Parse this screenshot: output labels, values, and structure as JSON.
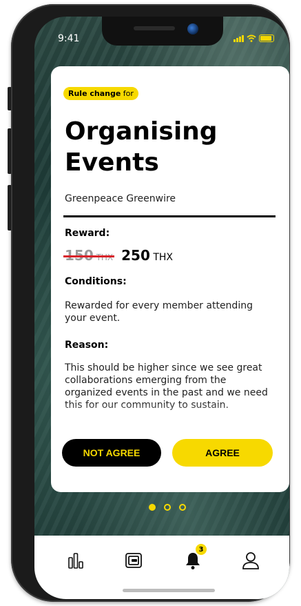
{
  "status": {
    "time": "9:41"
  },
  "card": {
    "badge_bold": "Rule change",
    "badge_rest": " for",
    "title": "Organising Events",
    "organization": "Greenpeace Greenwire",
    "reward_heading": "Reward:",
    "old_value": "150",
    "old_unit": " THX",
    "new_value": "250",
    "new_unit": " THX",
    "conditions_heading": "Conditions:",
    "conditions_text": "Rewarded for every member attending your event.",
    "reason_heading": "Reason:",
    "reason_text": "This should be higher since we see great collaborations emerging from the organized events in the past and we need this for our community to sustain.",
    "not_agree_label": "NOT AGREE",
    "agree_label": "AGREE"
  },
  "pager": {
    "count": 3,
    "active_index": 0
  },
  "tabbar": {
    "items": [
      {
        "icon": "bar-chart-icon"
      },
      {
        "icon": "wallet-icon"
      },
      {
        "icon": "bell-icon",
        "badge": "3"
      },
      {
        "icon": "user-icon"
      }
    ]
  },
  "colors": {
    "accent": "#f7d900",
    "strike": "#d8232a",
    "dark": "#000000"
  }
}
